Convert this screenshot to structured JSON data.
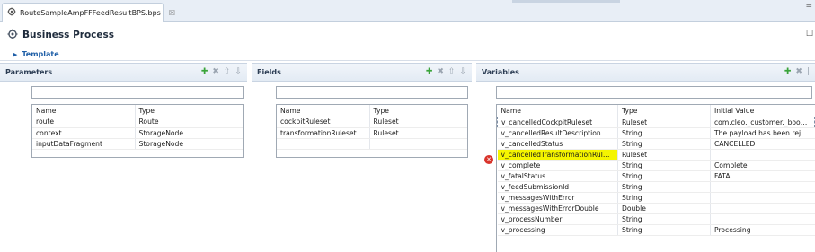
{
  "tab": {
    "label": "RouteSampleAmpFFFeedResultBPS.bps",
    "close": "☒"
  },
  "header": {
    "title": "Business Process",
    "icon": "gear-process-icon",
    "right_glyph": "☐"
  },
  "template": {
    "label": "Template",
    "expanded": false
  },
  "parameters": {
    "title": "Parameters",
    "filter_value": "",
    "columns": [
      "Name",
      "Type"
    ],
    "rows": [
      [
        "route",
        "Route"
      ],
      [
        "context",
        "StorageNode"
      ],
      [
        "inputDataFragment",
        "StorageNode"
      ]
    ]
  },
  "fields": {
    "title": "Fields",
    "filter_value": "",
    "columns": [
      "Name",
      "Type"
    ],
    "rows": [
      [
        "cockpitRuleset",
        "Ruleset"
      ],
      [
        "transformationRuleset",
        "Ruleset"
      ]
    ]
  },
  "variables": {
    "title": "Variables",
    "filter_value": "",
    "columns": [
      "Name",
      "Type",
      "Initial Value"
    ],
    "rows": [
      [
        "v_cancelledCockpitRuleset",
        "Ruleset",
        "com.cleo._customer._boost..."
      ],
      [
        "v_cancelledResultDescription",
        "String",
        "The payload has been reject..."
      ],
      [
        "v_cancelledStatus",
        "String",
        "CANCELLED"
      ],
      [
        "v_cancelledTransformationRuleset",
        "Ruleset",
        ""
      ],
      [
        "v_complete",
        "String",
        "Complete"
      ],
      [
        "v_fatalStatus",
        "String",
        "FATAL"
      ],
      [
        "v_feedSubmissionId",
        "String",
        ""
      ],
      [
        "v_messagesWithError",
        "String",
        ""
      ],
      [
        "v_messagesWithErrorDouble",
        "Double",
        ""
      ],
      [
        "v_processNumber",
        "String",
        ""
      ],
      [
        "v_processing",
        "String",
        "Processing"
      ]
    ],
    "highlight_color": "#f5f500",
    "error_row": 3
  },
  "colors": {
    "accent": "#1f5fa7",
    "header_text": "#1e2b3c",
    "add_tool": "#3aa43a",
    "error": "#d9342b"
  }
}
